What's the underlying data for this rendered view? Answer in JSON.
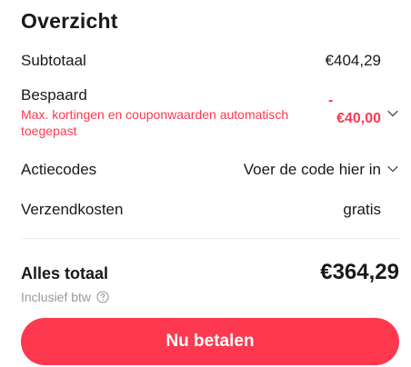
{
  "summary": {
    "title": "Overzicht",
    "subtotal": {
      "label": "Subtotaal",
      "value": "€404,29"
    },
    "saved": {
      "label": "Bespaard",
      "note": "Max. kortingen en couponwaarden automatisch toegepast",
      "value_sign": "-",
      "value": "€40,00"
    },
    "codes": {
      "label": "Actiecodes",
      "value": "Voer de code hier in"
    },
    "shipping": {
      "label": "Verzendkosten",
      "value": "gratis"
    },
    "total": {
      "label": "Alles totaal",
      "value": "€364,29"
    },
    "vat_note": "Inclusief btw",
    "pay_button": "Nu betalen"
  },
  "icons": {
    "saved_chevron": "chevron-down-icon",
    "codes_chevron": "chevron-down-icon",
    "vat_help": "question-circle-icon"
  },
  "colors": {
    "accent": "#fd384f",
    "text": "#191919",
    "muted": "#999999",
    "divider": "#ebebeb"
  }
}
